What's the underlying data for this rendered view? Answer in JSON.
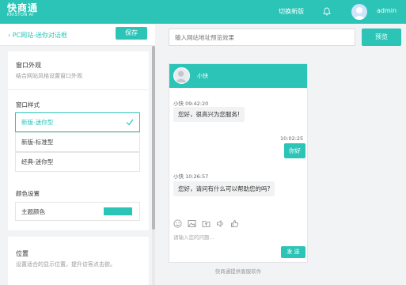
{
  "topbar": {
    "logo_cn": "快商通",
    "logo_en": "KRISTON AI",
    "switch_label": "切换新版",
    "username": "admin",
    "bell_icon": "bell-icon",
    "avatar_icon": "user-avatar-icon"
  },
  "left_header": {
    "back_label": "PC网站-迷你对话框",
    "save_label": "保存"
  },
  "window_look": {
    "title": "窗口外观",
    "desc": "结合网站风格设置窗口外观",
    "style_title": "窗口样式",
    "styles": [
      "新版-迷你型",
      "新版-标准型",
      "经典-迷你型"
    ],
    "selected_index": 0,
    "color_title": "颜色设置",
    "color_label": "主题颜色",
    "theme_color": "#2bc4b6"
  },
  "position": {
    "title": "位置",
    "desc": "设置适合的显示位置，提升访客点击欲。"
  },
  "preview": {
    "url_placeholder": "输入网站地址预览效果",
    "preview_label": "预览",
    "agent_name": "小快",
    "messages": [
      {
        "meta": "小快  09:42:20",
        "text": "您好，很高兴为您服务!"
      },
      {
        "meta": "10:02:25",
        "text": "你好"
      },
      {
        "meta": "小快  10:26:57",
        "text": "您好，请问有什么可以帮助您的吗?"
      }
    ],
    "input_placeholder": "请输入您的问题...",
    "send_label": "发 送",
    "footer_note": "快商通提供客服软件"
  }
}
